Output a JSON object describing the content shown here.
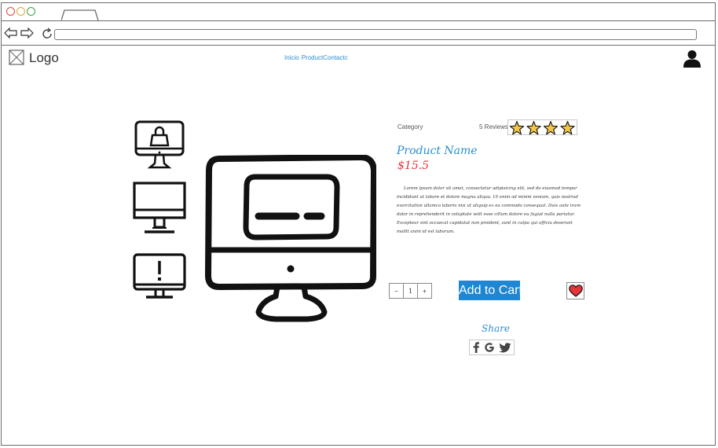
{
  "header": {
    "logo_text": "Logo",
    "nav": [
      "Inicio",
      "Product",
      "Contactc"
    ]
  },
  "product": {
    "category": "Category",
    "reviews": "5 Reviews",
    "rating": 4,
    "rating_max": 4,
    "name": "Product Name",
    "price": "$15.5",
    "description": "Lorem ipsum dolor sit amet, consectetur adipisicing elit, sed do eiusmod tempor incididunt ut labore et dolore magna aliqua. Ut enim ad minim veniam, quis nostrud exercitation ullamco laboris nisi ut aliquip ex ea commodo consequat. Duis aute irure dolor in reprehenderit in voluptate velit esse cillum dolore eu fugiat nulla pariatur. Excepteur sint occaecat cupidatat non proident, sunt in culpa qui officia deserunt mollit anim id est laborum.",
    "quantity": "1",
    "minus_label": "−",
    "plus_label": "+",
    "add_to_cart": "Add to Cart"
  },
  "share": {
    "label": "Share",
    "icons": [
      "facebook-icon",
      "google-icon",
      "twitter-icon"
    ]
  },
  "colors": {
    "accent": "#2a8fd0",
    "button": "#1e86d2",
    "price": "#e8333a",
    "star": "#f4c542",
    "heart": "#e8333a"
  }
}
